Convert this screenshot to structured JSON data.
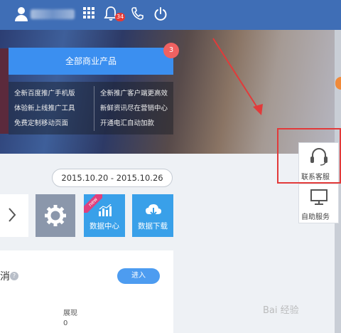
{
  "topbar": {
    "notification_count": "34",
    "icons": [
      "user-icon",
      "grid-icon",
      "bell-icon",
      "phone-icon",
      "power-icon"
    ]
  },
  "banner": {
    "product_button_label": "全部商业产品",
    "product_badge": "3",
    "menu_left": [
      "全新百度推广手机版",
      "体验新上线推广工具",
      "免费定制移动页面"
    ],
    "menu_right": [
      "全新推广客户端更高效",
      "新鲜资讯尽在营销中心",
      "开通电汇自动加款"
    ]
  },
  "main": {
    "date_range": "2015.10.20 - 2015.10.26",
    "tiles": {
      "new_ribbon": "new",
      "data_center": "数据中心",
      "data_download": "数据下载"
    },
    "promo": {
      "title_fragment": "消",
      "enter_button": "进入",
      "metric_label": "展现",
      "metric_value": "0"
    }
  },
  "service_panel": {
    "contact_label": "联系客服",
    "self_service_label": "自助服务"
  },
  "watermark": "Bai 经验",
  "colors": {
    "topbar": "#3f6eb6",
    "primary_button": "#3b8ff0",
    "tile_blue": "#39a0e9",
    "settings_tile": "#8b97ab",
    "highlight": "#e23a3a",
    "badge": "#e53935"
  }
}
